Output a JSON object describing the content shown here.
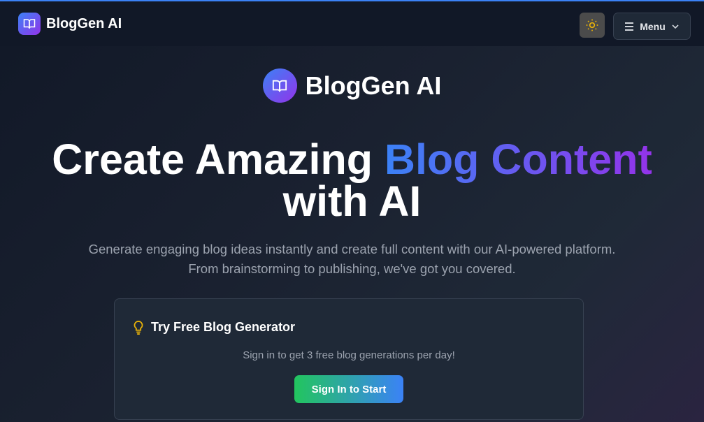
{
  "nav": {
    "brand": "BlogGen AI",
    "logo_icon": "book-open-icon",
    "theme_icon": "sun-icon",
    "menu_label": "Menu"
  },
  "hero": {
    "brand": "BlogGen AI",
    "title_part1": "Create Amazing ",
    "title_highlight": "Blog Content",
    "title_part2": "with AI",
    "subtitle": "Generate engaging blog ideas instantly and create full content with our AI-powered platform. From brainstorming to publishing, we've got you covered."
  },
  "card": {
    "title": "Try Free Blog Generator",
    "icon": "lightbulb-icon",
    "text": "Sign in to get 3 free blog generations per day!",
    "button": "Sign In to Start"
  },
  "colors": {
    "accent_blue": "#3b82f6",
    "accent_purple": "#9333ea",
    "green": "#22c55e",
    "bulb": "#eab308"
  }
}
